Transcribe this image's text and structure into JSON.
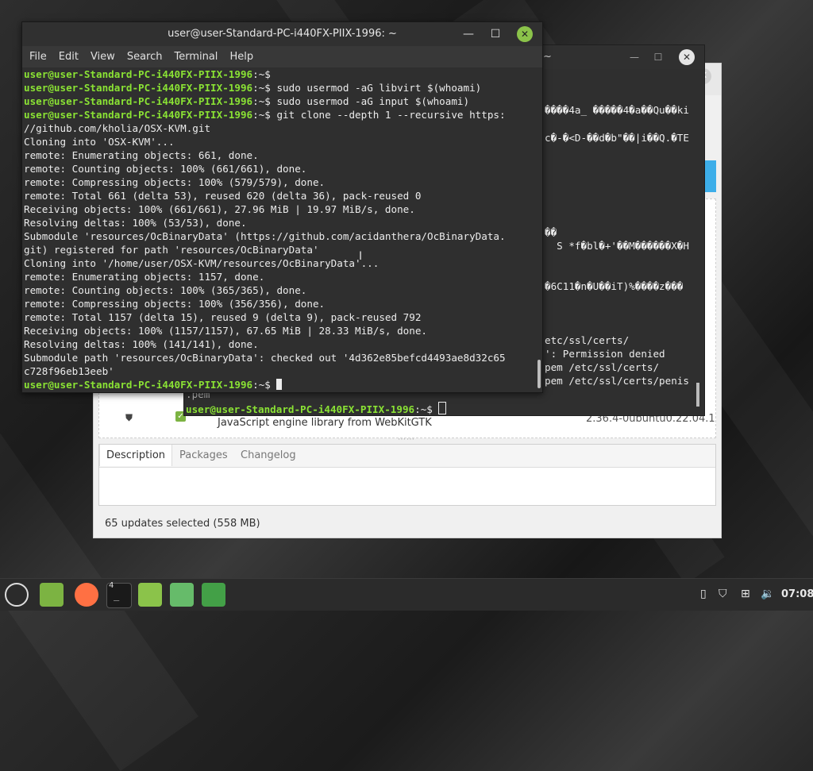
{
  "front_terminal": {
    "title": "user@user-Standard-PC-i440FX-PIIX-1996: ~",
    "menu": [
      "File",
      "Edit",
      "View",
      "Search",
      "Terminal",
      "Help"
    ],
    "prompt": "user@user-Standard-PC-i440FX-PIIX-1996",
    "prompt_suffix": ":~$",
    "lines": [
      {
        "prompt": true,
        "cmd": ""
      },
      {
        "prompt": true,
        "cmd": " sudo usermod -aG libvirt $(whoami)"
      },
      {
        "prompt": true,
        "cmd": " sudo usermod -aG input $(whoami)"
      },
      {
        "prompt": true,
        "cmd": " git clone --depth 1 --recursive https:"
      },
      {
        "prompt": false,
        "text": "//github.com/kholia/OSX-KVM.git"
      },
      {
        "prompt": false,
        "text": "Cloning into 'OSX-KVM'..."
      },
      {
        "prompt": false,
        "text": "remote: Enumerating objects: 661, done."
      },
      {
        "prompt": false,
        "text": "remote: Counting objects: 100% (661/661), done."
      },
      {
        "prompt": false,
        "text": "remote: Compressing objects: 100% (579/579), done."
      },
      {
        "prompt": false,
        "text": "remote: Total 661 (delta 53), reused 620 (delta 36), pack-reused 0"
      },
      {
        "prompt": false,
        "text": "Receiving objects: 100% (661/661), 27.96 MiB | 19.97 MiB/s, done."
      },
      {
        "prompt": false,
        "text": "Resolving deltas: 100% (53/53), done."
      },
      {
        "prompt": false,
        "text": "Submodule 'resources/OcBinaryData' (https://github.com/acidanthera/OcBinaryData."
      },
      {
        "prompt": false,
        "text": "git) registered for path 'resources/OcBinaryData'"
      },
      {
        "prompt": false,
        "text": "Cloning into '/home/user/OSX-KVM/resources/OcBinaryData'..."
      },
      {
        "prompt": false,
        "text": "remote: Enumerating objects: 1157, done."
      },
      {
        "prompt": false,
        "text": "remote: Counting objects: 100% (365/365), done."
      },
      {
        "prompt": false,
        "text": "remote: Compressing objects: 100% (356/356), done."
      },
      {
        "prompt": false,
        "text": "remote: Total 1157 (delta 15), reused 9 (delta 9), pack-reused 792"
      },
      {
        "prompt": false,
        "text": "Receiving objects: 100% (1157/1157), 67.65 MiB | 28.33 MiB/s, done."
      },
      {
        "prompt": false,
        "text": "Resolving deltas: 100% (141/141), done."
      },
      {
        "prompt": false,
        "text": "Submodule path 'resources/OcBinaryData': checked out '4d362e85befcd4493ae8d32c65"
      },
      {
        "prompt": false,
        "text": "c728f96eb13eeb'"
      },
      {
        "prompt": true,
        "cmd": " ",
        "cursor": true
      }
    ]
  },
  "back_terminal": {
    "title": "~",
    "lines": [
      "\u0000\u0000\u0000\u00004a_ \u0000\u0000\u0000\u0000\u00004\u0000a\u0000\u0000Qu\u0000\u0000ki",
      "c\u0000-\u0000<D-\u0000\u0000d\u0000b\"\u0000\u0000|i\u0000\u0000Q.\u0000TE",
      "\u0000\u0000",
      "  S *f\u0000bl\u0000+'\u0000\u0000M\u0000\u0000\u0000\u0000\u0000\u0000X\u0000H",
      "\u00006C11\u0000n\u0000U\u0000\u0000iT)%\u0000\u0000\u0000\u0000z\u0000\u0000\u0000",
      "etc/ssl/certs/",
      "': Permission denied",
      "pem /etc/ssl/certs/",
      "pem /etc/ssl/certs/penis"
    ],
    "pem_label": ".pem",
    "prompt": "user@user-Standard-PC-i440FX-PIIX-1996",
    "prompt_suffix": ":~$"
  },
  "update_manager": {
    "package_description": "JavaScript engine library from WebKitGTK",
    "package_version": "2.36.4-0ubuntu0.22.04.1",
    "tabs": [
      "Description",
      "Packages",
      "Changelog"
    ],
    "status": "65 updates selected (558 MB)"
  },
  "taskbar": {
    "workspace_badge": "4",
    "clock": "07:08"
  }
}
